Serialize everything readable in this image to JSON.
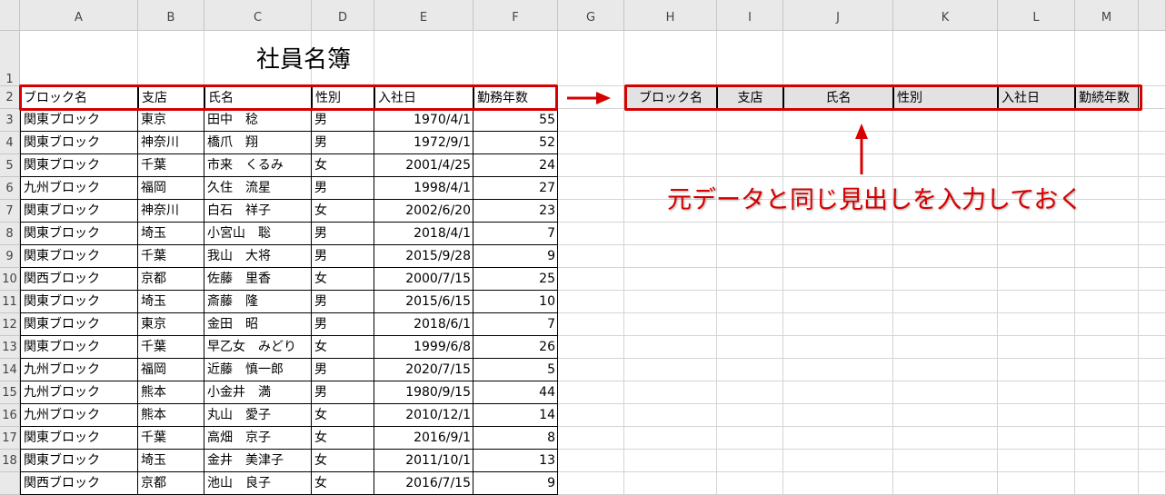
{
  "columns": [
    "A",
    "B",
    "C",
    "D",
    "E",
    "F",
    "G",
    "H",
    "I",
    "J",
    "K",
    "L",
    "M"
  ],
  "rows": [
    "1",
    "2",
    "3",
    "4",
    "5",
    "6",
    "7",
    "8",
    "9",
    "10",
    "11",
    "12",
    "13",
    "14",
    "15",
    "16",
    "17",
    "18",
    ""
  ],
  "title": "社員名簿",
  "source_headers": [
    "ブロック名",
    "支店",
    "氏名",
    "性別",
    "入社日",
    "勤務年数"
  ],
  "target_headers": [
    "ブロック名",
    "支店",
    "氏名",
    "性別",
    "入社日",
    "勤続年数"
  ],
  "records": [
    [
      "関東ブロック",
      "東京",
      "田中　稔",
      "男",
      "1970/4/1",
      "55"
    ],
    [
      "関東ブロック",
      "神奈川",
      "橋爪　翔",
      "男",
      "1972/9/1",
      "52"
    ],
    [
      "関東ブロック",
      "千葉",
      "市来　くるみ",
      "女",
      "2001/4/25",
      "24"
    ],
    [
      "九州ブロック",
      "福岡",
      "久住　流星",
      "男",
      "1998/4/1",
      "27"
    ],
    [
      "関東ブロック",
      "神奈川",
      "白石　祥子",
      "女",
      "2002/6/20",
      "23"
    ],
    [
      "関東ブロック",
      "埼玉",
      "小宮山　聡",
      "男",
      "2018/4/1",
      "7"
    ],
    [
      "関東ブロック",
      "千葉",
      "我山　大将",
      "男",
      "2015/9/28",
      "9"
    ],
    [
      "関西ブロック",
      "京都",
      "佐藤　里香",
      "女",
      "2000/7/15",
      "25"
    ],
    [
      "関東ブロック",
      "埼玉",
      "斎藤　隆",
      "男",
      "2015/6/15",
      "10"
    ],
    [
      "関東ブロック",
      "東京",
      "金田　昭",
      "男",
      "2018/6/1",
      "7"
    ],
    [
      "関東ブロック",
      "千葉",
      "早乙女　みどり",
      "女",
      "1999/6/8",
      "26"
    ],
    [
      "九州ブロック",
      "福岡",
      "近藤　慎一郎",
      "男",
      "2020/7/15",
      "5"
    ],
    [
      "九州ブロック",
      "熊本",
      "小金井　満",
      "男",
      "1980/9/15",
      "44"
    ],
    [
      "九州ブロック",
      "熊本",
      "丸山　愛子",
      "女",
      "2010/12/1",
      "14"
    ],
    [
      "関東ブロック",
      "千葉",
      "高畑　京子",
      "女",
      "2016/9/1",
      "8"
    ],
    [
      "関東ブロック",
      "埼玉",
      "金井　美津子",
      "女",
      "2011/10/1",
      "13"
    ],
    [
      "関西ブロック",
      "京都",
      "池山　良子",
      "女",
      "2016/7/15",
      "9"
    ]
  ],
  "annotation": "元データと同じ見出しを入力しておく",
  "accent_color": "#d60000"
}
